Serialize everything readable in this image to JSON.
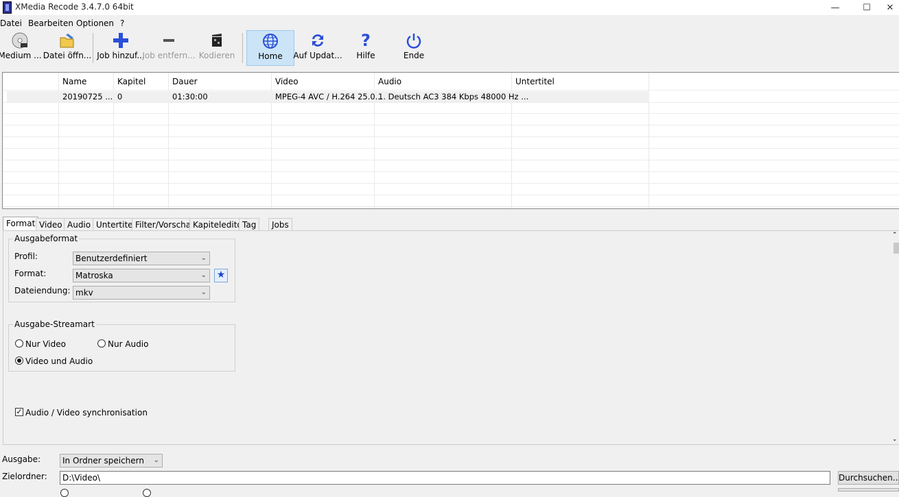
{
  "window": {
    "title": "XMedia Recode 3.4.7.0 64bit"
  },
  "menu": [
    "Datei",
    "Bearbeiten",
    "Optionen",
    "?"
  ],
  "toolbar": {
    "medium": "Medium ...",
    "open_file": "Datei öffn...",
    "add_job": "Job hinzuf...",
    "remove_job": "Job entfern...",
    "encode": "Kodieren",
    "home": "Home",
    "update": "Auf Updat...",
    "help": "Hilfe",
    "exit": "Ende"
  },
  "table": {
    "columns": [
      "Name",
      "Kapitel",
      "Dauer",
      "Video",
      "Audio",
      "Untertitel"
    ],
    "rows": [
      {
        "name": "20190725 ...",
        "kapitel": "0",
        "dauer": "01:30:00",
        "video": "MPEG-4 AVC / H.264 25.0...",
        "audio": "1. Deutsch AC3 384 Kbps 48000 Hz ...",
        "untertitel": ""
      }
    ]
  },
  "tabs": [
    "Format",
    "Video",
    "Audio",
    "Untertitel",
    "Filter/Vorschau",
    "Kapiteleditor",
    "Tag",
    "Jobs"
  ],
  "format_panel": {
    "output_format_title": "Ausgabeformat",
    "profile_label": "Profil:",
    "profile_value": "Benutzerdefiniert",
    "format_label": "Format:",
    "format_value": "Matroska",
    "extension_label": "Dateiendung:",
    "extension_value": "mkv",
    "stream_title": "Ausgabe-Streamart",
    "only_video": "Nur Video",
    "only_audio": "Nur Audio",
    "video_and_audio": "Video und Audio",
    "sync_label": "Audio / Video synchronisation"
  },
  "bottom": {
    "output_label": "Ausgabe:",
    "output_value": "In Ordner speichern",
    "target_label": "Zielordner:",
    "target_value": "D:\\Video\\",
    "browse": "Durchsuchen..."
  }
}
